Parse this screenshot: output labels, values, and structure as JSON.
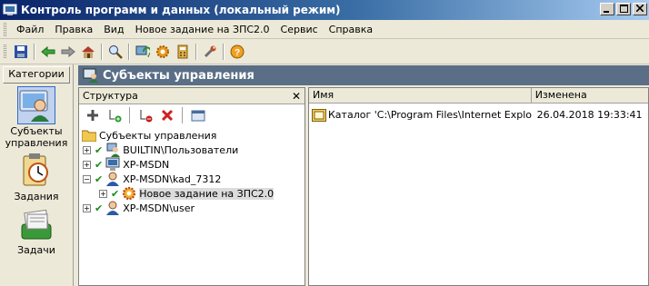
{
  "window": {
    "title": "Контроль программ и данных (локальный режим)"
  },
  "menu": [
    "Файл",
    "Правка",
    "Вид",
    "Новое задание на ЗПС2.0",
    "Сервис",
    "Справка"
  ],
  "toolbar": {
    "icons": [
      "save-icon",
      "back-arrow-icon",
      "forward-arrow-icon",
      "home-icon",
      "search-icon",
      "refresh-icon",
      "gear-icon",
      "calculator-icon",
      "wrench-icon",
      "help-icon"
    ]
  },
  "sidebar": {
    "header": "Категории",
    "items": [
      {
        "label": "Субъекты управления",
        "icon": "user-computer-icon",
        "selected": true
      },
      {
        "label": "Задания",
        "icon": "clipboard-clock-icon",
        "selected": false
      },
      {
        "label": "Задачи",
        "icon": "card-file-icon",
        "selected": false
      }
    ]
  },
  "banner": {
    "title": "Субъекты управления"
  },
  "tree_panel": {
    "title": "Структура",
    "toolbar_icons": [
      "add-icon",
      "add-child-icon",
      "remove-icon",
      "delete-icon",
      "folder-view-icon"
    ],
    "root": "Субъекты управления",
    "nodes": [
      {
        "label": "BUILTIN\\Пользователи",
        "checked": true,
        "expander": "+"
      },
      {
        "label": "XP-MSDN",
        "checked": true,
        "expander": "+"
      },
      {
        "label": "XP-MSDN\\kad_7312",
        "checked": true,
        "expander": "−"
      },
      {
        "label": "Новое задание на ЗПС2.0",
        "checked": true,
        "expander": "+"
      },
      {
        "label": "XP-MSDN\\user",
        "checked": true,
        "expander": "+"
      }
    ]
  },
  "list_panel": {
    "columns": [
      "Имя",
      "Изменена"
    ],
    "rows": [
      {
        "name": "Каталог 'C:\\Program Files\\Internet Explorer'",
        "modified": "26.04.2018   19:33:41"
      }
    ]
  }
}
